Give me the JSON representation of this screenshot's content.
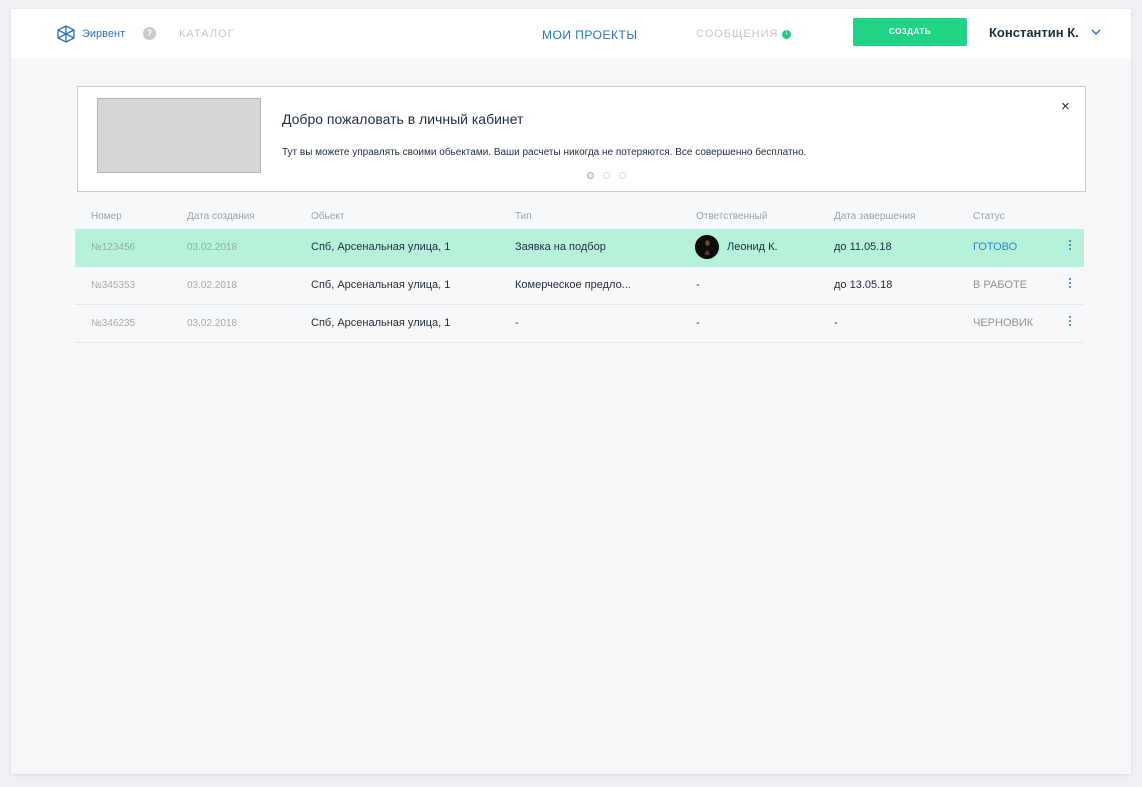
{
  "nav": {
    "brand": "Эирвент",
    "help": "?",
    "catalog": "КАТАЛОГ",
    "projects": "МОИ ПРОЕКТЫ",
    "messages": "СООБЩЕНИЯ",
    "messages_badge": "!",
    "create": "СОЗДАТЬ",
    "user": "Константин К."
  },
  "banner": {
    "title": "Добро пожаловать в личный кабинет",
    "text": "Тут вы можете управлять своими обьектами. Ваши расчеты никогда не потеряются.  Все совершенно бесплатно.",
    "close": "×",
    "active_slide": 1,
    "slide_count": 3
  },
  "table": {
    "headers": [
      "Номер",
      "Дата создания",
      "Обьект",
      "Тип",
      "Ответственный",
      "Дата завершения",
      "Статус"
    ],
    "rows": [
      {
        "number": "№123456",
        "created": "03.02.2018",
        "object": "Спб, Арсенальная улица, 1",
        "type": "Заявка на подбор",
        "responsible": "Леонид К.",
        "due": "до 11.05.18",
        "status": "ГОТОВО"
      },
      {
        "number": "№345353",
        "created": "03.02.2018",
        "object": "Спб, Арсенальная улица, 1",
        "type": "Комерческое предло...",
        "responsible": "-",
        "due": "до 13.05.18",
        "status": "В РАБОТЕ"
      },
      {
        "number": "№346235",
        "created": "03.02.2018",
        "object": "Спб, Арсенальная улица, 1",
        "type": "-",
        "responsible": "-",
        "due": "-",
        "status": "ЧЕРНОВИК"
      }
    ]
  },
  "icons": {
    "logo": "logo-icon",
    "help": "help-icon",
    "chevron": "chevron-down-icon",
    "close": "close-icon",
    "menu": "kebab-menu-icon"
  },
  "colors": {
    "accent": "#2a73b8",
    "create": "#1fd486",
    "highlight_row": "#b6f2da",
    "status_ready": "#2a86c8"
  }
}
